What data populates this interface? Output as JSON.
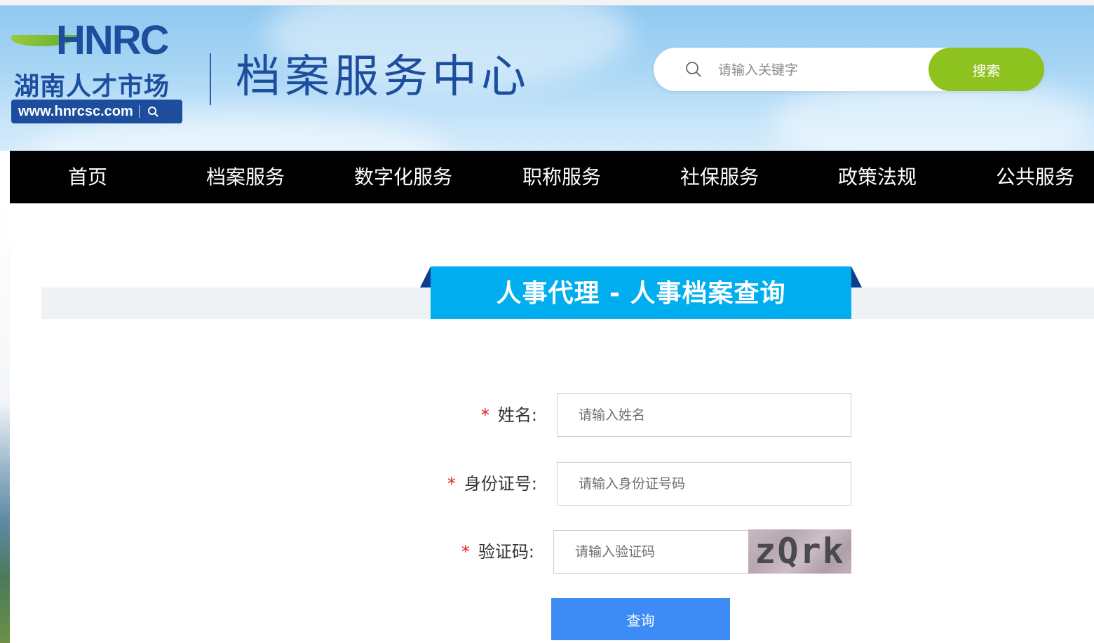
{
  "header": {
    "logo_text": "HNRC",
    "logo_cn": "湖南人才市场",
    "logo_url": "www.hnrcsc.com",
    "site_title": "档案服务中心",
    "search": {
      "placeholder": "请输入关键字",
      "button_label": "搜索"
    }
  },
  "nav": {
    "items": [
      {
        "label": "首页"
      },
      {
        "label": "档案服务"
      },
      {
        "label": "数字化服务"
      },
      {
        "label": "职称服务"
      },
      {
        "label": "社保服务"
      },
      {
        "label": "政策法规"
      },
      {
        "label": "公共服务"
      }
    ]
  },
  "section": {
    "title": "人事代理 - 人事档案查询"
  },
  "form": {
    "required_mark": "*",
    "name": {
      "label": "姓名:",
      "placeholder": "请输入姓名"
    },
    "id_number": {
      "label": "身份证号:",
      "placeholder": "请输入身份证号码"
    },
    "captcha": {
      "label": "验证码:",
      "placeholder": "请输入验证码",
      "image_text": "zQrk"
    },
    "submit_label": "查询"
  },
  "colors": {
    "brand_blue": "#1d4e9e",
    "search_button": "#8dc21f",
    "nav_background": "#000000",
    "section_title_bg": "#00aeef",
    "submit_button": "#3d8cf5",
    "required_mark": "#e0201c"
  },
  "icons": {
    "search": "search-icon",
    "logo_mini_search": "search-icon"
  }
}
